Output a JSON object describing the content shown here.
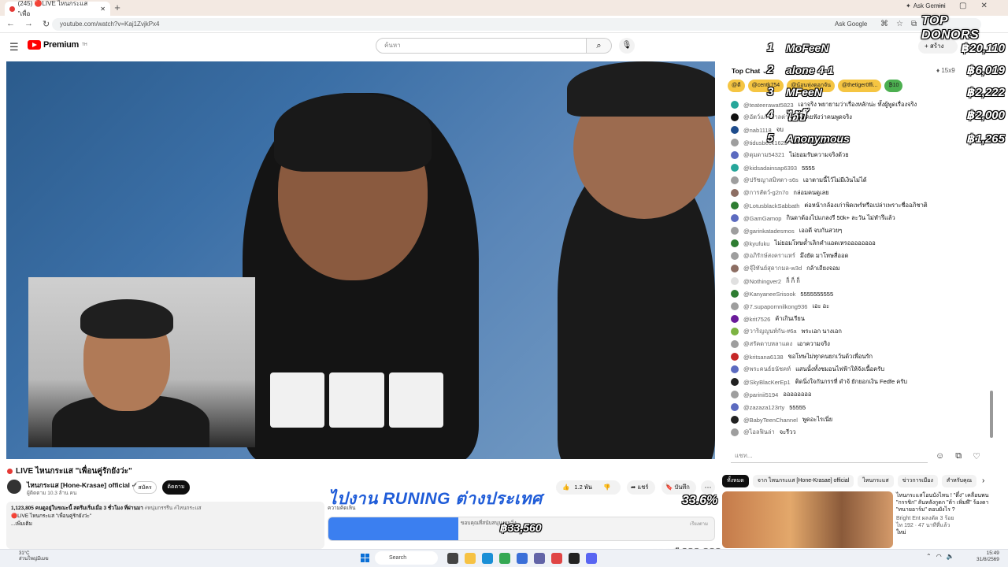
{
  "browser": {
    "tab_title": "(245) 🔴LIVE ไหนกระแส \"เพื่อ",
    "tab_count": "",
    "url": "youtube.com/watch?v=Kaj1ZvjkPx4",
    "ask_gemini": "Ask Gemini",
    "ask_google": "Ask Google"
  },
  "youtube": {
    "logo_text": "Premium",
    "logo_sup": "TH",
    "search_placeholder": "ค้นหา",
    "create_label": "สร้าง"
  },
  "top_donors": {
    "header": "TOP DONORS",
    "rows": [
      {
        "rank": "1",
        "name": "MoFeeN",
        "amount": "฿20,110"
      },
      {
        "rank": "2",
        "name": "alone 4-1",
        "amount": "฿6,019"
      },
      {
        "rank": "3",
        "name": "MFeeN",
        "amount": "฿2,222"
      },
      {
        "rank": "4",
        "name": "ไอ้ปึ๊",
        "amount": "฿2,000"
      },
      {
        "rank": "5",
        "name": "Anonymous",
        "amount": "฿1,265"
      }
    ]
  },
  "chat": {
    "mode": "Top Chat",
    "viewer_count": "15x9",
    "pinned": [
      {
        "name": "@ดี",
        "color": "#f5c542"
      },
      {
        "name": "@centk754",
        "color": "#f5c542"
      },
      {
        "name": "@น้อนทุ่งดอกจัน",
        "color": "#f5c542"
      },
      {
        "name": "@thetiger0ffi...",
        "color": "#f5c542"
      },
      {
        "name": "₿10",
        "color": "#4caf50"
      }
    ],
    "messages": [
      {
        "author": "@teateerawat5823",
        "text": "เอาจริง พยายามว่าเรื่องหลักน่ะ ทั้งผู้พูดเรื่องจริง",
        "color": "#26a69a"
      },
      {
        "author": "@อัตว์แก้วกาลต่า",
        "text": "ก็ไม่เคยฟังว่าคนพูดจริง",
        "color": "#111111"
      },
      {
        "author": "@nab1118",
        "text": "จบ",
        "color": "#1e4c8c"
      },
      {
        "author": "@tidusbeck1625",
        "text": "อะไร ของจบ",
        "color": "#9e9e9e"
      },
      {
        "author": "@ดุมดาม54321",
        "text": "ไม่ยอมรับความจริงด้วย",
        "color": "#5c6bc0"
      },
      {
        "author": "@kidsadainsap6393",
        "text": "5555",
        "color": "#26a69a"
      },
      {
        "author": "@ปรัชญาสมิทตา-s6s",
        "text": "เอาตามนี้ไว้ไม่มีเงินไม่ได้",
        "color": "#9e9e9e"
      },
      {
        "author": "@การสัตว์-g2n7o",
        "text": "กล่อมคนดูเลย",
        "color": "#8d6e63"
      },
      {
        "author": "@LotusblackSabbath",
        "text": "ต่อหน้ากล้องเก่าพิดเพร์หรือเปล่าเพราะชื่ออภิชาติ",
        "color": "#2e7d32"
      },
      {
        "author": "@GamGamop",
        "text": "กินดาด้องไปแกลงรี 50k+ ละวัน ไม่ทำรึแล้ว",
        "color": "#5c6bc0"
      },
      {
        "author": "@garinkatadesmos",
        "text": "เออดี จบกันสวยๆ",
        "color": "#9e9e9e"
      },
      {
        "author": "@kyufuku",
        "text": "ไม่ยอมโทษด้ำเลิกคำแอดเหรออออออออ",
        "color": "#2e7d32"
      },
      {
        "author": "@อภิรักษ์สงคราแหร์",
        "text": "มึงยัด มาโทษสื่ออด",
        "color": "#9e9e9e"
      },
      {
        "author": "@จุ๊งิทันย์สุดากมล-w3d",
        "text": "กล้าเถียงจอม",
        "color": "#8d6e63"
      },
      {
        "author": "@Nothingver2",
        "text": "ก็ ก็ ก็",
        "color": "#e0e0e0"
      },
      {
        "author": "@KanyaneeSrisook",
        "text": "5555555555",
        "color": "#2e7d32"
      },
      {
        "author": "@7.supapornnilkong936",
        "text": "เอะ อะ",
        "color": "#9e9e9e"
      },
      {
        "author": "@krit7526",
        "text": "ค้าเกินเรียน",
        "color": "#6a1b9a"
      },
      {
        "author": "@วาริญญนท์กัน-#6a",
        "text": "พระเอก นางเอก",
        "color": "#7cb342"
      },
      {
        "author": "@สรัคดาบหลาแดง",
        "text": "เอาความจริง",
        "color": "#9e9e9e"
      },
      {
        "author": "@kritsana6138",
        "text": "ขอโทษไม่ทุกคนยกเว้นด้วเพื่อนรัก",
        "color": "#c62828"
      },
      {
        "author": "@พระคนธ์ธนัชคท์",
        "text": "แสนนั้งทั้งชมอนไฟฟ้าให้จังเนื้อครับ",
        "color": "#5c6bc0"
      },
      {
        "author": "@SkyBlacKerEp1",
        "text": "ติดนิ่งใจกันกรรที่ ดำจ้ ยักยอกเงิน Fedfe ครับ",
        "color": "#212121"
      },
      {
        "author": "@parinii5194",
        "text": "ออออออออ",
        "color": "#9e9e9e"
      },
      {
        "author": "@zazaza123rty",
        "text": "55555",
        "color": "#5c6bc0"
      },
      {
        "author": "@BabyTeenChannel",
        "text": "พูดอะไรเนี่ย",
        "color": "#212121"
      },
      {
        "author": "@ไอลฟินล่า",
        "text": "จะรีวว",
        "color": "#9e9e9e"
      }
    ],
    "input_placeholder": "แชท..."
  },
  "video": {
    "title": "LIVE ไหนกระแส \"เพื่อนคู่รักยังว่ะ\"",
    "channel_name": "ไหนกระแส [Hone-Krasae] official",
    "subscribers": "ผู้ติดตาม 10.3 ล้าน คน",
    "join_label": "สมัคร",
    "subscribe_label": "ติดตาม",
    "likes": "1.2 พัน",
    "share_label": "แชร์",
    "save_label": "บันทึก",
    "desc_stats": "1,123,805 คนดูอยู่ในขณะนี้ สตรีมเริ่มเมื่อ 3 ชั่วโมง ที่ผ่านมา",
    "desc_tags": "#หนุ่มกรรรีน #ไหนกระแส",
    "desc_line2": "🔴LIVE ไหนกระแส \"เพื่อนคู่รักยังว่ะ\"",
    "desc_more": "...เพิ่มเติม"
  },
  "goal": {
    "title": "ไปงาน RUNING ต่างประเทศ",
    "percent_label": "33.6%",
    "progress": 0.336,
    "raised": "฿33,560",
    "target": "จาก ฿100,000",
    "comments_label": "ความคิดเห็น",
    "sub_text": "ขอบคุณที่สนับสนุนงานวิ่ง",
    "button": "เรียงตาม"
  },
  "recommendations": {
    "chips": [
      "ทั้งหมด",
      "จาก ไหนกระแส [Hone-Krasae] official",
      "ไหนกระแส",
      "ข่าวการเมือง",
      "สำหรับคุณ"
    ],
    "item": {
      "title": "ไหนกระแสโอนบังไหน ! \"ตึ๋ง\" เคลื่อนพน \"กรรชิก\" ลันหลังกูดก \"ต้า เพิ่มพี\" ร้องดา \"ทนายอาร์ม\" ตอบยังไร ?",
      "channel": "Bright Ent ผลงดัด 3 ร้อย",
      "stats": "ไท 192 · 47 นาทีที่แล้ว",
      "badge": "ใหม่"
    }
  },
  "taskbar": {
    "weather_temp": "31°C",
    "weather_desc": "ส่วนใหญ่มีเมฆ",
    "search": "Search",
    "time": "15:49",
    "date": "31/8/2569"
  }
}
